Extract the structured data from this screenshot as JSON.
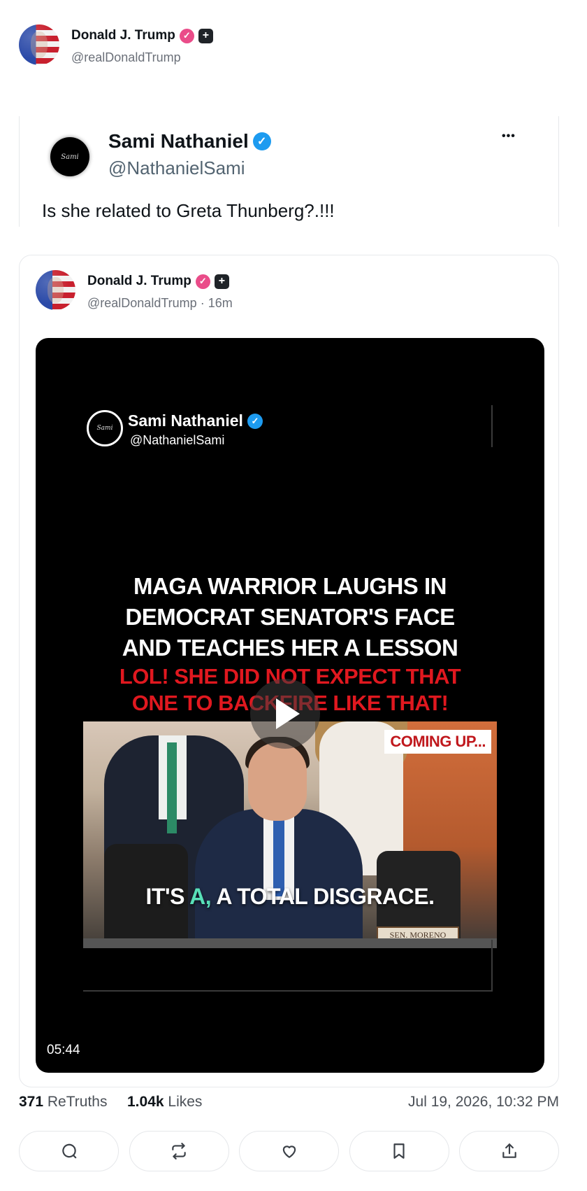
{
  "top_post": {
    "author_name": "Donald J. Trump",
    "author_handle": "@realDonaldTrump"
  },
  "quoted_tweet": {
    "author_name": "Sami Nathaniel",
    "author_handle": "@NathanielSami",
    "avatar_text": "Sami",
    "more_glyph": "•••",
    "text": "Is she related to Greta Thunberg?.!!!"
  },
  "inner_post": {
    "author_name": "Donald J. Trump",
    "author_handle": "@realDonaldTrump",
    "time_separator": "·",
    "time_ago": "16m"
  },
  "video": {
    "overlay_name": "Sami Nathaniel",
    "overlay_handle": "@NathanielSami",
    "overlay_avatar_text": "Sami",
    "headline_lines": [
      "MAGA WARRIOR LAUGHS IN",
      "DEMOCRAT SENATOR'S FACE",
      "AND TEACHES HER A LESSON"
    ],
    "red_lines": [
      "LOL! SHE DID NOT EXPECT THAT",
      "ONE TO BACKFIRE LIKE THAT!"
    ],
    "coming_up": "COMING UP...",
    "caption_pre": "IT'S ",
    "caption_accent": "A,",
    "caption_post": " A TOTAL DISGRACE.",
    "nameplate": "SEN. MORENO",
    "duration": "05:44"
  },
  "stats": {
    "retruths_count": "371",
    "retruths_label": " ReTruths",
    "likes_count": "1.04k",
    "likes_label": " Likes",
    "date": "Jul 19, 2026, 10:32 PM"
  },
  "actions": [
    {
      "name": "reply",
      "icon": "reply-icon"
    },
    {
      "name": "retruth",
      "icon": "retruth-icon"
    },
    {
      "name": "like",
      "icon": "heart-icon"
    },
    {
      "name": "bookmark",
      "icon": "bookmark-icon"
    },
    {
      "name": "share",
      "icon": "share-icon"
    }
  ],
  "colors": {
    "verified_pink": "#ea4c89",
    "verified_blue": "#1d9bf0",
    "headline_red": "#e0181f",
    "caption_accent": "#58e0b8"
  }
}
